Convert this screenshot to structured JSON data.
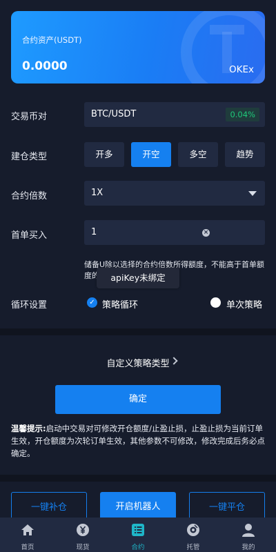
{
  "asset_card": {
    "label": "合约资产(USDT)",
    "amount": "0.0000",
    "exchange": "OKEx"
  },
  "pair": {
    "label": "交易币对",
    "value": "BTC/USDT",
    "change": "0.04%"
  },
  "position_type": {
    "label": "建仓类型",
    "options": [
      "开多",
      "开空",
      "多空",
      "趋势"
    ],
    "selected": "开空"
  },
  "leverage": {
    "label": "合约倍数",
    "value": "1X"
  },
  "first_order": {
    "label": "首单买入",
    "value": "1",
    "clear_glyph": "×",
    "note": "储备U除以选择的合约倍数所得额度，不能高于首单额度的倍数"
  },
  "toast": "apiKey未绑定",
  "cycle": {
    "label": "循环设置",
    "options": [
      "策略循环",
      "单次策略"
    ],
    "selected": "策略循环",
    "check_glyph": "✓"
  },
  "custom_strategy": "自定义策略类型",
  "confirm_label": "确定",
  "tip": {
    "title": "温馨提示:",
    "text": "启动中交易对可修改开仓额度/止盈止损，止盈止损为当前订单生效，开仓额度为次轮订单生效，其他参数不可修改，修改完成后务必点确定。"
  },
  "actions": [
    "一键补仓",
    "开启机器人",
    "一键平仓"
  ],
  "tabs": [
    {
      "label": "首页",
      "icon": "home-icon"
    },
    {
      "label": "现货",
      "icon": "yen-coin-icon"
    },
    {
      "label": "合约",
      "icon": "list-icon"
    },
    {
      "label": "托管",
      "icon": "custody-icon"
    },
    {
      "label": "我的",
      "icon": "user-icon"
    }
  ],
  "active_tab": "合约",
  "colors": {
    "background": "#161c2c",
    "accent": "#1580f0",
    "positive": "#1fc87a",
    "active_tab": "#1fb6c8"
  }
}
